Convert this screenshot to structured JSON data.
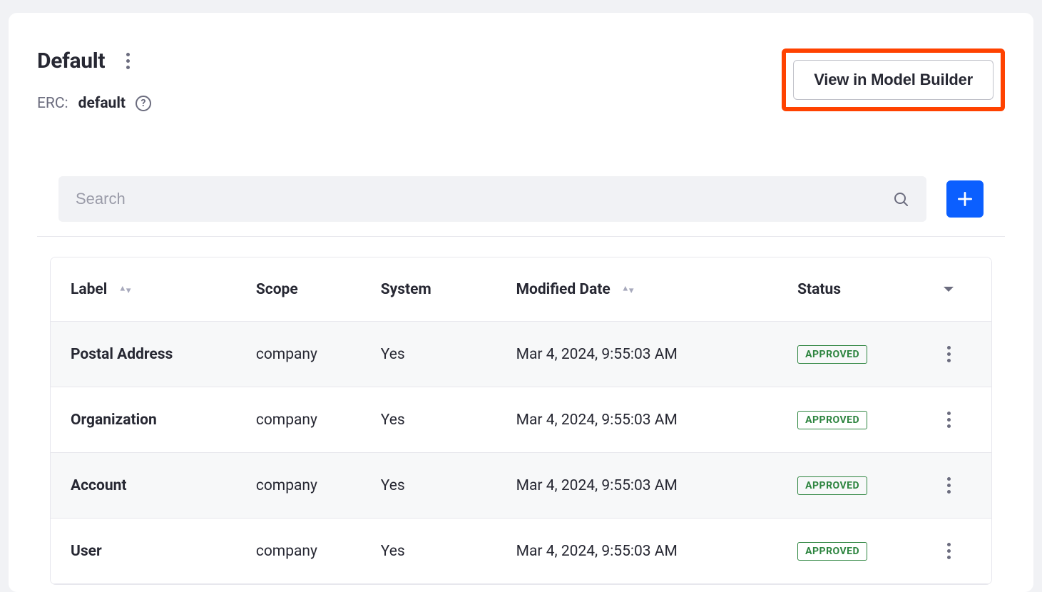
{
  "header": {
    "title": "Default",
    "erc_label": "ERC:",
    "erc_value": "default",
    "view_button": "View in Model Builder"
  },
  "toolbar": {
    "search_placeholder": "Search"
  },
  "table": {
    "columns": {
      "label": "Label",
      "scope": "Scope",
      "system": "System",
      "modified": "Modified Date",
      "status": "Status"
    },
    "rows": [
      {
        "label": "Postal Address",
        "scope": "company",
        "system": "Yes",
        "modified": "Mar 4, 2024, 9:55:03 AM",
        "status": "APPROVED"
      },
      {
        "label": "Organization",
        "scope": "company",
        "system": "Yes",
        "modified": "Mar 4, 2024, 9:55:03 AM",
        "status": "APPROVED"
      },
      {
        "label": "Account",
        "scope": "company",
        "system": "Yes",
        "modified": "Mar 4, 2024, 9:55:03 AM",
        "status": "APPROVED"
      },
      {
        "label": "User",
        "scope": "company",
        "system": "Yes",
        "modified": "Mar 4, 2024, 9:55:03 AM",
        "status": "APPROVED"
      }
    ]
  }
}
